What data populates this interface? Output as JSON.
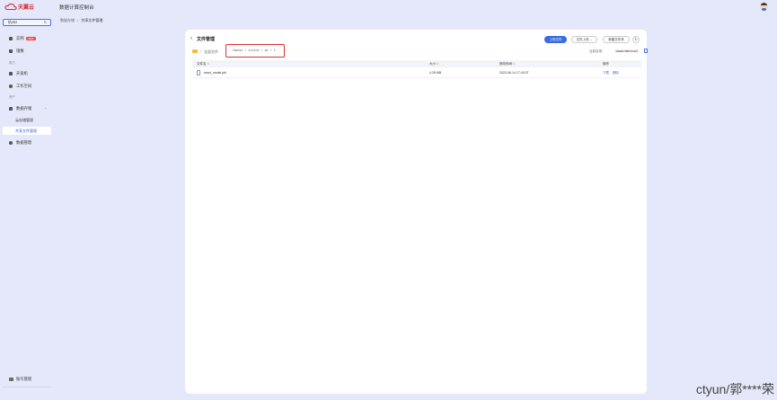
{
  "header": {
    "brand": "天翼云",
    "console_title": "数据计算控制台"
  },
  "sidebar": {
    "region": "杭州2",
    "items": [
      {
        "label": "实例",
        "badge": "NEW"
      },
      {
        "label": "镜像"
      },
      {
        "label": "开发机"
      },
      {
        "label": "工作空间"
      },
      {
        "label": "数据存储"
      },
      {
        "label": "数据管理"
      }
    ],
    "group_labels": [
      "算力",
      "资产"
    ],
    "sub_items": [
      "云存储管理",
      "共享文件管理"
    ],
    "bottom_item": "账号管理"
  },
  "breadcrumb": {
    "parent": "数据存储",
    "separator": "/",
    "current": "共享文件管理"
  },
  "panel": {
    "title": "文件管理",
    "upload_button": "上传文件",
    "folder_upload_button": "文件上传",
    "new_folder_button": "新建文件夹",
    "path_root": "全部文件",
    "path_current": "/data1 / stitch / ai / 1",
    "current_dir_label": "当前目录：",
    "current_dir_value": "/data1/stitch/ai/1"
  },
  "table": {
    "columns": [
      "文件名",
      "大小",
      "修改时间",
      "操作"
    ],
    "rows": [
      {
        "name": "react_model.pth",
        "size": "4.28 MB",
        "modified": "2023-06-14 17:43:37",
        "actions": [
          "下载",
          "删除"
        ]
      }
    ]
  },
  "watermark": "ctyun/郭****荣"
}
